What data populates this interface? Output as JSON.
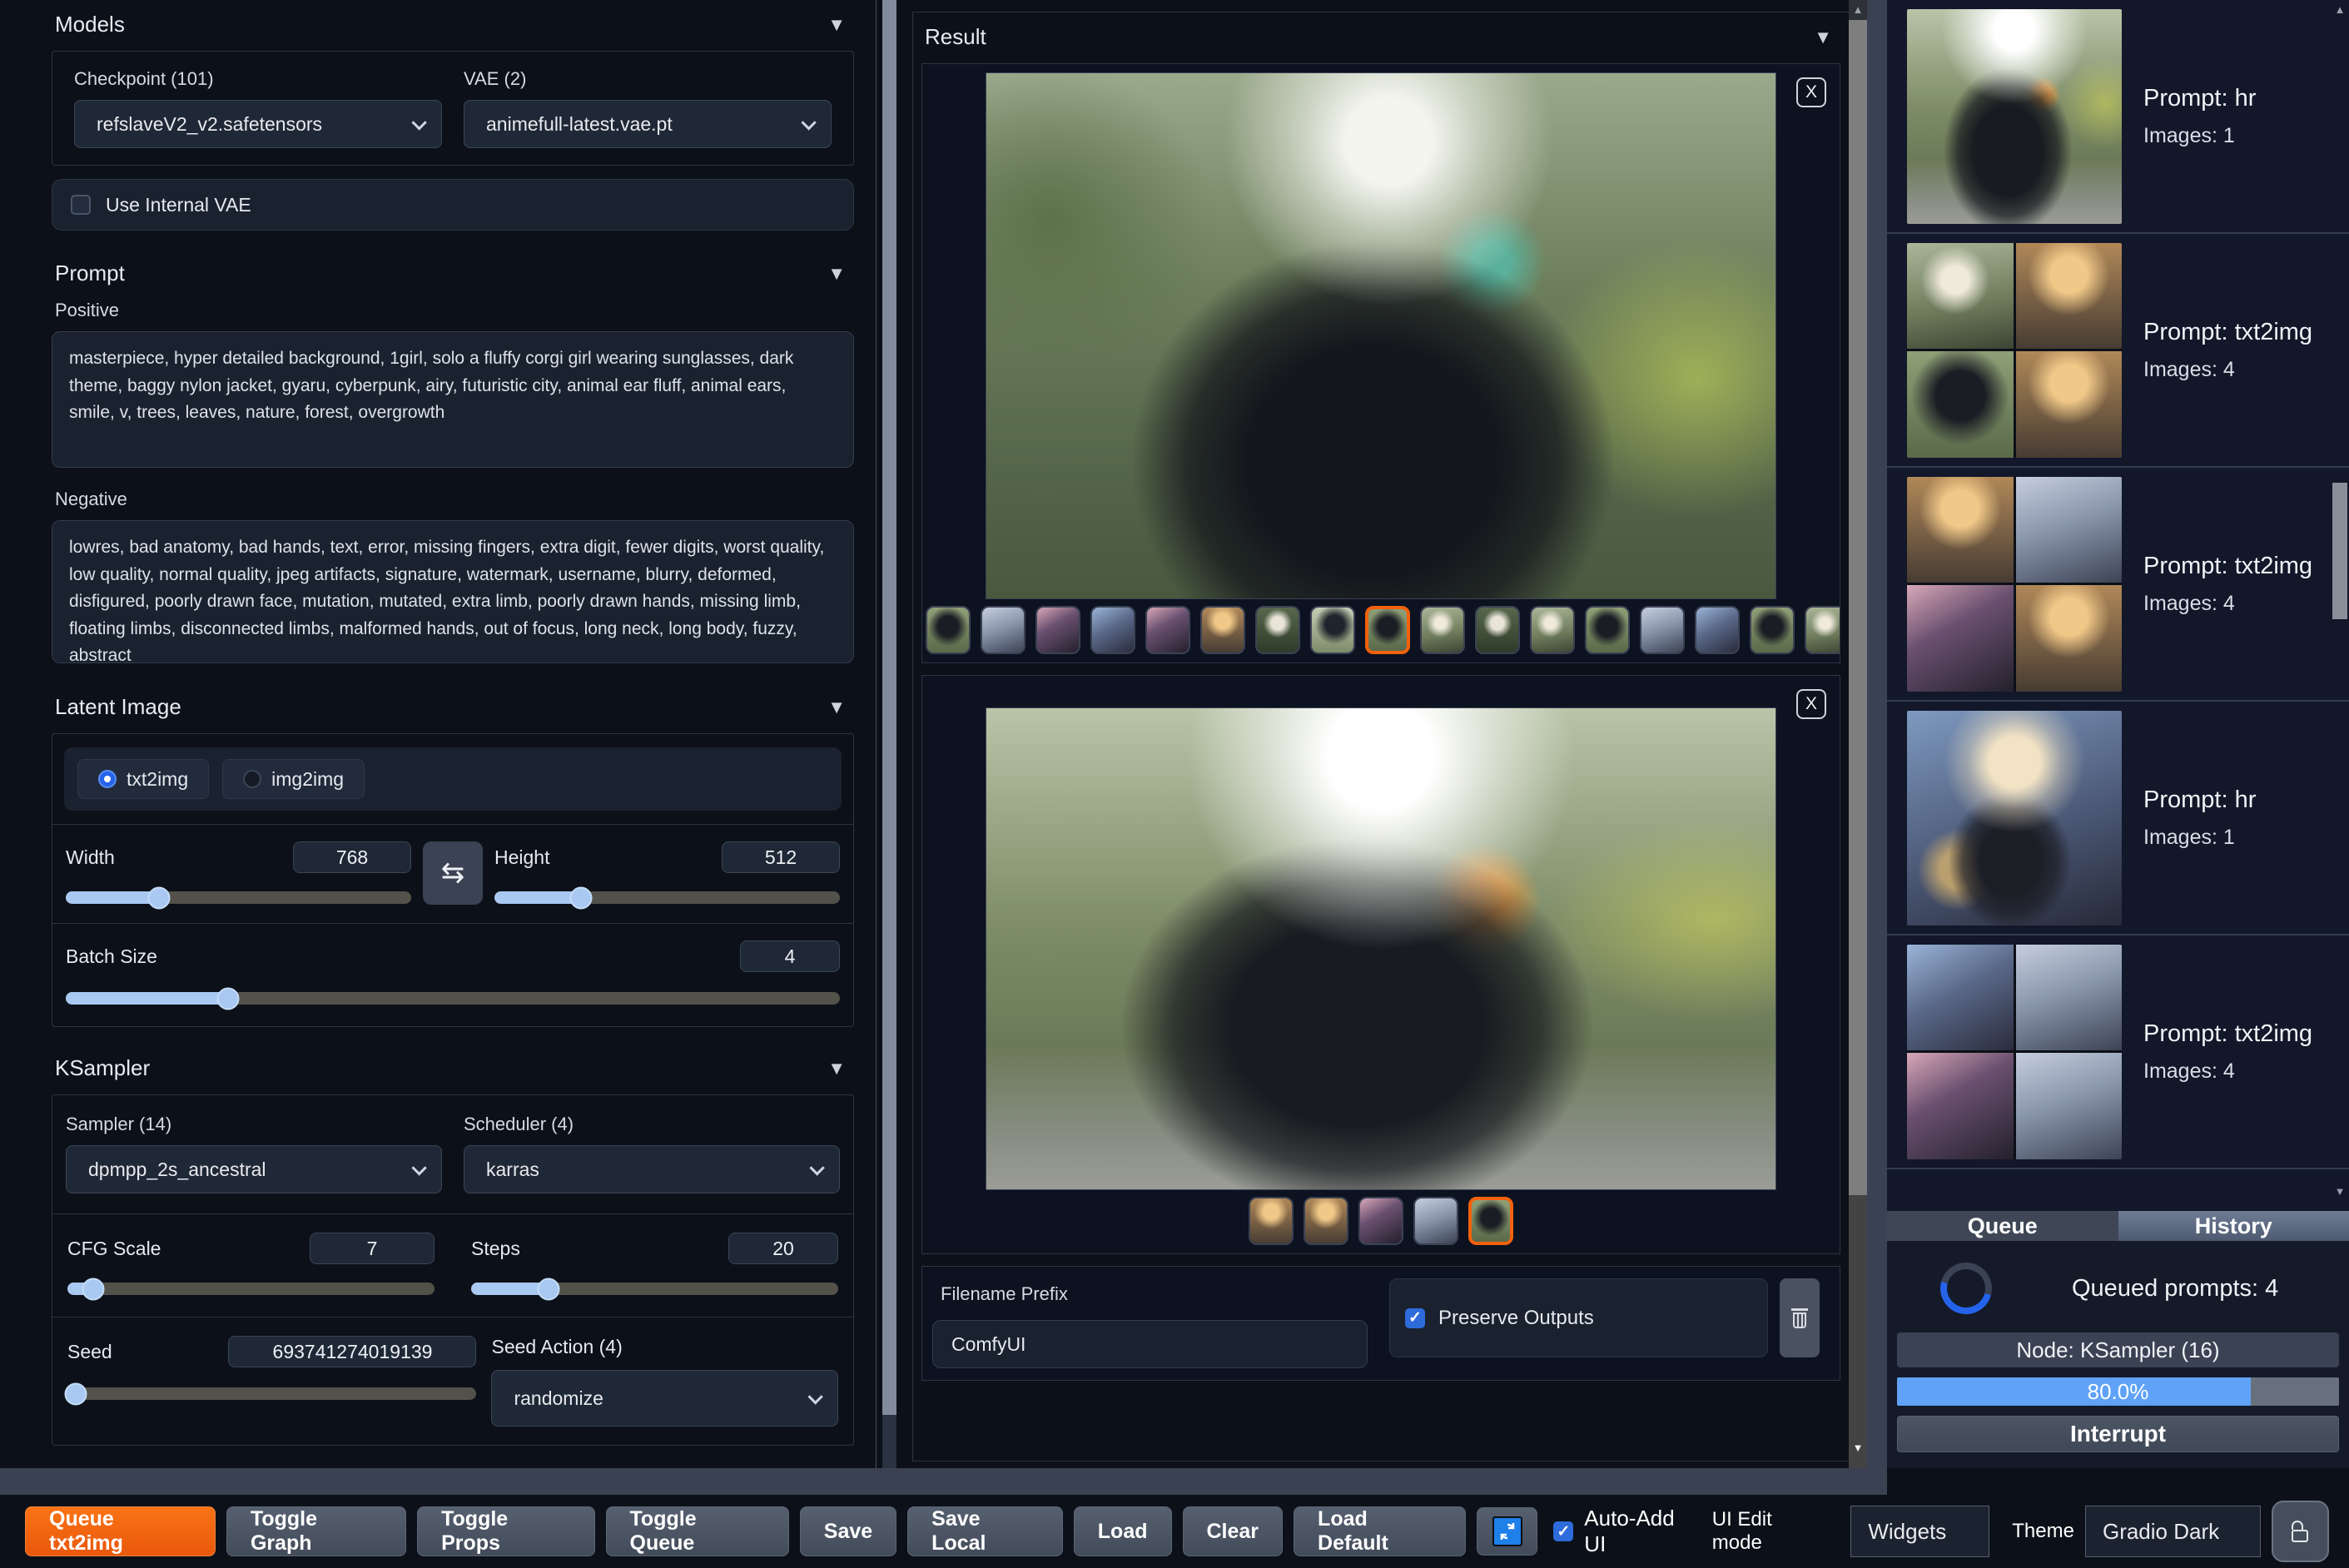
{
  "accent_orange": "#f2610d",
  "accent_blue": "#2563eb",
  "models": {
    "title": "Models",
    "checkpoint_label": "Checkpoint (101)",
    "checkpoint_value": "refslaveV2_v2.safetensors",
    "vae_label": "VAE (2)",
    "vae_value": "animefull-latest.vae.pt",
    "use_internal_vae_label": "Use Internal VAE",
    "use_internal_vae_checked": false
  },
  "prompt": {
    "title": "Prompt",
    "positive_label": "Positive",
    "positive_value": "masterpiece, hyper detailed background, 1girl, solo a fluffy corgi girl wearing sunglasses, dark theme, baggy nylon jacket, gyaru, cyberpunk, airy, futuristic city, animal ear fluff, animal ears, smile, v, trees, leaves, nature, forest, overgrowth",
    "negative_label": "Negative",
    "negative_value": "lowres, bad anatomy, bad hands, text, error, missing fingers, extra digit, fewer digits, worst quality, low quality, normal quality, jpeg artifacts, signature, watermark, username, blurry, deformed, disfigured, poorly drawn face, mutation, mutated, extra limb, poorly drawn hands, missing limb, floating limbs, disconnected limbs, malformed hands, out of focus, long neck, long body, fuzzy, abstract"
  },
  "latent": {
    "title": "Latent Image",
    "mode_txt2img": "txt2img",
    "mode_img2img": "img2img",
    "selected_mode": "txt2img",
    "width_label": "Width",
    "width_value": "768",
    "width_pct": 27,
    "height_label": "Height",
    "height_value": "512",
    "height_pct": 25,
    "batch_label": "Batch Size",
    "batch_value": "4",
    "batch_pct": 21
  },
  "ksampler": {
    "title": "KSampler",
    "sampler_label": "Sampler (14)",
    "sampler_value": "dpmpp_2s_ancestral",
    "scheduler_label": "Scheduler (4)",
    "scheduler_value": "karras",
    "cfg_label": "CFG Scale",
    "cfg_value": "7",
    "cfg_pct": 7,
    "steps_label": "Steps",
    "steps_value": "20",
    "steps_pct": 21,
    "seed_label": "Seed",
    "seed_value": "693741274019139",
    "seed_pct": 2,
    "seed_action_label": "Seed Action (4)",
    "seed_action_value": "randomize"
  },
  "result": {
    "title": "Result",
    "close_label": "X",
    "image1": "anime-wolf-girl-sunglasses-forest",
    "image2": "anime-girl-cap-corgi-forest",
    "gallery1": {
      "selected": 8,
      "tiles": [
        "t2",
        "t7",
        "t3",
        "t4",
        "t3",
        "t5",
        "t1",
        "t8",
        "t2",
        "t6",
        "t1",
        "t6",
        "t2",
        "t7",
        "t4",
        "t2",
        "t6"
      ]
    },
    "gallery2": {
      "selected": 4,
      "tiles": [
        "t5",
        "t5",
        "t3",
        "t7",
        "t2"
      ]
    },
    "filename_label": "Filename Prefix",
    "filename_value": "ComfyUI",
    "preserve_label": "Preserve Outputs",
    "preserve_checked": true
  },
  "sidebar": {
    "items": [
      {
        "prompt": "Prompt: hr",
        "images": "Images: 1",
        "type": "single",
        "art": [
          "art-forest-cap"
        ]
      },
      {
        "prompt": "Prompt: txt2img",
        "images": "Images: 4",
        "type": "grid",
        "art": [
          "t6",
          "t5",
          "t2",
          "t5"
        ]
      },
      {
        "prompt": "Prompt: txt2img",
        "images": "Images: 4",
        "type": "grid",
        "art": [
          "t5",
          "t7",
          "t3",
          "t5"
        ]
      },
      {
        "prompt": "Prompt: hr",
        "images": "Images: 1",
        "type": "single",
        "art": [
          "art-city-fox"
        ]
      },
      {
        "prompt": "Prompt: txt2img",
        "images": "Images: 4",
        "type": "grid",
        "art": [
          "t4",
          "t7",
          "t3",
          "t7"
        ]
      }
    ],
    "tab_queue": "Queue",
    "tab_history": "History",
    "queued_text": "Queued prompts: 4",
    "node_text": "Node: KSampler (16)",
    "progress_text": "80.0%",
    "progress_pct": 80,
    "interrupt_label": "Interrupt"
  },
  "bottom_bar": {
    "buttons": [
      {
        "label": "Queue txt2img",
        "kind": "primary"
      },
      {
        "label": "Toggle Graph"
      },
      {
        "label": "Toggle Props"
      },
      {
        "label": "Toggle Queue"
      },
      {
        "label": "Save"
      },
      {
        "label": "Save Local"
      },
      {
        "label": "Load"
      },
      {
        "label": "Clear"
      },
      {
        "label": "Load Default"
      }
    ],
    "auto_add_label": "Auto-Add UI",
    "auto_add_checked": true,
    "ui_edit_label": "UI Edit mode",
    "widgets_value": "Widgets",
    "theme_label": "Theme",
    "theme_value": "Gradio Dark"
  }
}
